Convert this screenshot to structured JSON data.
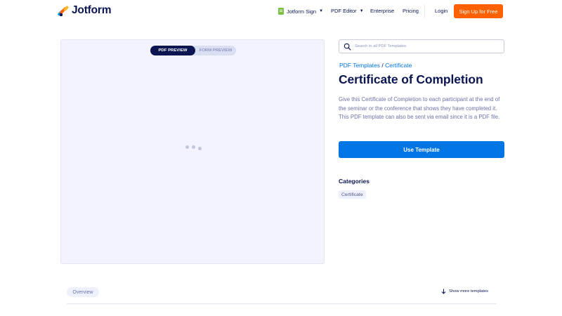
{
  "brand": {
    "name": "Jotform",
    "logo_colors": [
      "#0099ff",
      "#ff6100",
      "#ffb629",
      "#0a1551"
    ]
  },
  "nav": {
    "items": [
      {
        "label": "Jotform Sign",
        "has_dropdown": true,
        "icon": "sign-document-icon"
      },
      {
        "label": "PDF Editor",
        "has_dropdown": true
      },
      {
        "label": "Enterprise",
        "has_dropdown": false
      },
      {
        "label": "Pricing",
        "has_dropdown": false
      }
    ],
    "login_label": "Login",
    "signup_label": "Sign Up for Free"
  },
  "preview": {
    "tabs": [
      {
        "label": "PDF PREVIEW",
        "active": true
      },
      {
        "label": "FORM PREVIEW",
        "active": false
      }
    ],
    "state": "loading"
  },
  "search": {
    "placeholder": "Search in all PDF Templates",
    "value": ""
  },
  "breadcrumb": {
    "items": [
      "PDF Templates",
      "Certificate"
    ],
    "separator": "/"
  },
  "template": {
    "title": "Certificate of Completion",
    "description": "Give this Certificate of Completion to each participant at the end of the seminar or the conference that shows they have completed it. This PDF template can also be sent via email since it is a PDF file.",
    "use_button_label": "Use Template"
  },
  "categories": {
    "heading": "Categories",
    "tags": [
      "Certificate"
    ]
  },
  "bottom": {
    "tab_label": "Overview",
    "more_label": "Show more templates"
  },
  "colors": {
    "navy": "#0a1551",
    "orange": "#ff6100",
    "blue": "#0075e3",
    "preview_bg": "#f3f3fe"
  }
}
